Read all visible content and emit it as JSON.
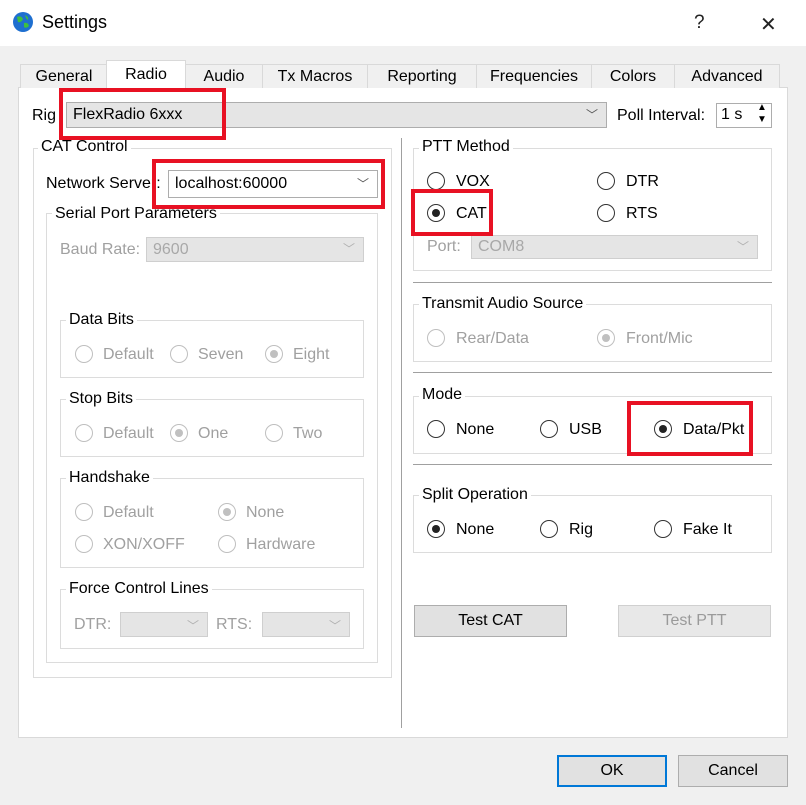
{
  "window": {
    "title": "Settings",
    "help": "?",
    "close": "✕"
  },
  "tabs": [
    "General",
    "Radio",
    "Audio",
    "Tx Macros",
    "Reporting",
    "Frequencies",
    "Colors",
    "Advanced"
  ],
  "rig": {
    "label": "Rig",
    "value": "FlexRadio 6xxx",
    "poll_label": "Poll Interval:",
    "poll_value": "1 s"
  },
  "cat": {
    "title": "CAT Control",
    "server_label": "Network Server:",
    "server_value": "localhost:60000",
    "serial": {
      "title": "Serial Port Parameters",
      "baud_label": "Baud Rate:",
      "baud_value": "9600",
      "data_bits": {
        "title": "Data Bits",
        "options": [
          "Default",
          "Seven",
          "Eight"
        ],
        "selected": 2
      },
      "stop_bits": {
        "title": "Stop Bits",
        "options": [
          "Default",
          "One",
          "Two"
        ],
        "selected": 1
      },
      "handshake": {
        "title": "Handshake",
        "options": [
          "Default",
          "None",
          "XON/XOFF",
          "Hardware"
        ],
        "selected": 1
      },
      "force": {
        "title": "Force Control Lines",
        "dtr_label": "DTR:",
        "rts_label": "RTS:"
      }
    }
  },
  "ptt": {
    "title": "PTT Method",
    "options": [
      "VOX",
      "DTR",
      "CAT",
      "RTS"
    ],
    "selected": 2,
    "port_label": "Port:",
    "port_value": "COM8"
  },
  "audio_src": {
    "title": "Transmit Audio Source",
    "options": [
      "Rear/Data",
      "Front/Mic"
    ],
    "selected": 1
  },
  "mode": {
    "title": "Mode",
    "options": [
      "None",
      "USB",
      "Data/Pkt"
    ],
    "selected": 2
  },
  "split": {
    "title": "Split Operation",
    "options": [
      "None",
      "Rig",
      "Fake It"
    ],
    "selected": 0
  },
  "buttons": {
    "test_cat": "Test CAT",
    "test_ptt": "Test PTT",
    "ok": "OK",
    "cancel": "Cancel"
  },
  "colors": {
    "highlight": "#e81123",
    "ok_border": "#0078d7"
  }
}
